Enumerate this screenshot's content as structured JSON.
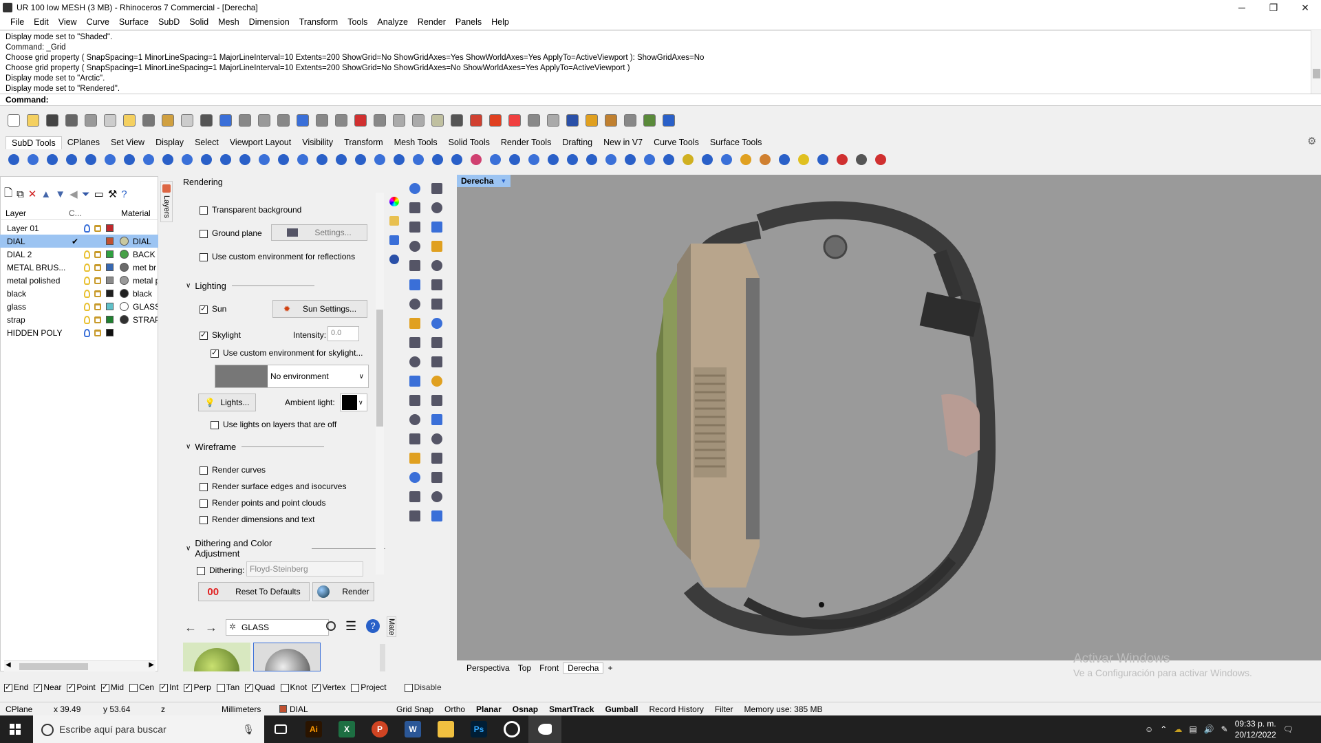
{
  "window": {
    "title": "UR 100 low MESH (3 MB) - Rhinoceros 7 Commercial - [Derecha]"
  },
  "menu": [
    "File",
    "Edit",
    "View",
    "Curve",
    "Surface",
    "SubD",
    "Solid",
    "Mesh",
    "Dimension",
    "Transform",
    "Tools",
    "Analyze",
    "Render",
    "Panels",
    "Help"
  ],
  "history": [
    "Display mode set to \"Shaded\".",
    "Command: _Grid",
    "Choose grid property ( SnapSpacing=1  MinorLineSpacing=1  MajorLineInterval=10  Extents=200  ShowGrid=No  ShowGridAxes=Yes  ShowWorldAxes=Yes  ApplyTo=ActiveViewport ): ShowGridAxes=No",
    "Choose grid property ( SnapSpacing=1  MinorLineSpacing=1  MajorLineInterval=10  Extents=200  ShowGrid=No  ShowGridAxes=No  ShowWorldAxes=Yes  ApplyTo=ActiveViewport )",
    "Display mode set to \"Arctic\".",
    "Display mode set to \"Rendered\"."
  ],
  "command_label": "Command:",
  "tabs": [
    "SubD Tools",
    "CPlanes",
    "Set View",
    "Display",
    "Select",
    "Viewport Layout",
    "Visibility",
    "Transform",
    "Mesh Tools",
    "Solid Tools",
    "Render Tools",
    "Drafting",
    "New in V7",
    "Curve Tools",
    "Surface Tools"
  ],
  "layers": {
    "header": {
      "name": "Layer",
      "col2": "C...",
      "material": "Material"
    },
    "tab_label": "Layers",
    "rows": [
      {
        "name": "Layer 01",
        "bulb": "#3a6fd8",
        "swatch": "#c0282c",
        "ball": "",
        "mat": ""
      },
      {
        "name": "DIAL",
        "bulb": "",
        "swatch": "#c05030",
        "ball": "#c8c8a0",
        "mat": "DIAL",
        "current": "✔"
      },
      {
        "name": "DIAL 2",
        "bulb": "#e8c030",
        "swatch": "#30a040",
        "ball": "#48a048",
        "mat": "BACK I"
      },
      {
        "name": "METAL BRUS...",
        "bulb": "#e8c030",
        "swatch": "#3868b0",
        "ball": "#6a6a6a",
        "mat": "met br"
      },
      {
        "name": "metal polished",
        "bulb": "#e8c030",
        "swatch": "#8a8a8a",
        "ball": "#9a9a9a",
        "mat": "metal p"
      },
      {
        "name": "black",
        "bulb": "#e8c030",
        "swatch": "#202020",
        "ball": "#202020",
        "mat": "black"
      },
      {
        "name": "glass",
        "bulb": "#e8c030",
        "swatch": "#60c0c8",
        "ball": "#ffffff",
        "mat": "GLASS"
      },
      {
        "name": "strap",
        "bulb": "#e8c030",
        "swatch": "#208030",
        "ball": "#303030",
        "mat": "STRAP"
      },
      {
        "name": "HIDDEN POLY",
        "bulb": "#3a6fd8",
        "swatch": "#101010",
        "ball": "",
        "mat": ""
      }
    ]
  },
  "rendering": {
    "title": "Rendering",
    "transparent_bg": "Transparent background",
    "ground_plane": "Ground plane",
    "settings": "Settings...",
    "custom_env_reflections": "Use custom environment for reflections",
    "lighting": "Lighting",
    "sun": "Sun",
    "sun_settings": "Sun Settings...",
    "skylight": "Skylight",
    "intensity_label": "Intensity:",
    "intensity": "0.0",
    "custom_env_skylight": "Use custom environment for skylight...",
    "no_env": "No environment",
    "lights": "Lights...",
    "ambient": "Ambient light:",
    "lights_off": "Use lights on layers that are off",
    "wireframe": "Wireframe",
    "render_curves": "Render curves",
    "render_edges": "Render surface edges and isocurves",
    "render_points": "Render points and point clouds",
    "render_dims": "Render dimensions and text",
    "dithering_section": "Dithering and Color Adjustment",
    "dithering": "Dithering:",
    "dither_method": "Floyd-Steinberg",
    "reset": "Reset To Defaults",
    "render": "Render",
    "reset_icon": "00"
  },
  "materials": {
    "search": "GLASS",
    "tab": "Mate"
  },
  "viewport": {
    "name": "Derecha",
    "tabs": [
      "Perspectiva",
      "Top",
      "Front",
      "Derecha"
    ],
    "add": "+"
  },
  "watermark": {
    "line1": "Activar Windows",
    "line2": "Ve a Configuración para activar Windows."
  },
  "osnap": [
    {
      "l": "End",
      "on": true
    },
    {
      "l": "Near",
      "on": true
    },
    {
      "l": "Point",
      "on": true
    },
    {
      "l": "Mid",
      "on": true
    },
    {
      "l": "Cen",
      "on": false
    },
    {
      "l": "Int",
      "on": true
    },
    {
      "l": "Perp",
      "on": true
    },
    {
      "l": "Tan",
      "on": false
    },
    {
      "l": "Quad",
      "on": true
    },
    {
      "l": "Knot",
      "on": false
    },
    {
      "l": "Vertex",
      "on": true
    },
    {
      "l": "Project",
      "on": false
    },
    {
      "l": "Disable",
      "on": false
    }
  ],
  "status": {
    "cplane": "CPlane",
    "x": "x 39.49",
    "y": "y 53.64",
    "z": "z",
    "units": "Millimeters",
    "layer": "DIAL",
    "grid_snap": "Grid Snap",
    "ortho": "Ortho",
    "planar": "Planar",
    "osnap": "Osnap",
    "smarttrack": "SmartTrack",
    "gumball": "Gumball",
    "record": "Record History",
    "filter": "Filter",
    "memory": "Memory use: 385 MB"
  },
  "taskbar": {
    "search": "Escribe aquí para buscar",
    "time": "09:33 p. m.",
    "date": "20/12/2022"
  },
  "colors": {
    "selection": "#9cc4f2",
    "viewport_bg": "#9a9a9a",
    "watch_case": "#b8a58c",
    "strap": "#3a3a3a"
  }
}
